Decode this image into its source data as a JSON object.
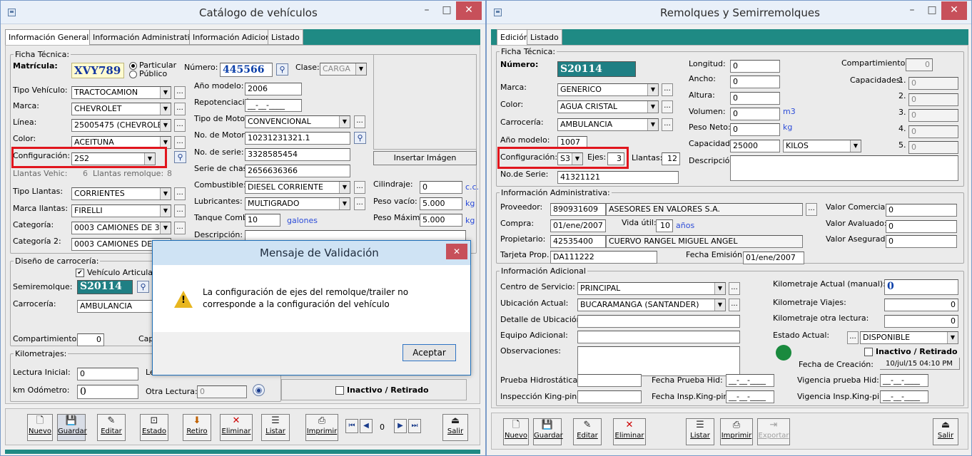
{
  "left": {
    "title": "Catálogo de vehículos",
    "tabs": [
      "Información General",
      "Información Administrativa",
      "Información Adicional",
      "Listado"
    ],
    "ficha": {
      "group_label": "Ficha Técnica:",
      "matricula_label": "Matrícula:",
      "matricula": "XVY789",
      "particular": "Particular",
      "publico": "Público",
      "numero_label": "Número:",
      "numero": "445566",
      "clase_label": "Clase:",
      "clase": "CARGA",
      "tipo_vehiculo_label": "Tipo Vehículo:",
      "tipo_vehiculo": "TRACTOCAMION",
      "marca_label": "Marca:",
      "marca": "CHEVROLET",
      "linea_label": "Línea:",
      "linea": "25005475 (CHEVROLET)",
      "color_label": "Color:",
      "color": "ACEITUNA",
      "configuracion_label": "Configuración:",
      "configuracion": "2S2",
      "llantas_veh_label": "Llantas Vehic:",
      "llantas_veh": "6",
      "llantas_rem_label": "Llantas remolque:",
      "llantas_rem": "8",
      "tipo_llantas_label": "Tipo Llantas:",
      "tipo_llantas": "CORRIENTES",
      "marca_llantas_label": "Marca llantas:",
      "marca_llantas": "FIRELLI",
      "categoria_label": "Categoría:",
      "categoria": "0003 CAMIONES DE 3 Y",
      "categoria2_label": "Categoría 2:",
      "categoria2": "0003 CAMIONES DE 3 Y",
      "anio_modelo_label": "Año modelo:",
      "anio_modelo": "2006",
      "repotenciacion_label": "Repotenciación",
      "repotenciacion": "__-__-____",
      "tipo_motor_label": "Tipo de Motor:",
      "tipo_motor": "CONVENCIONAL",
      "no_motor_label": "No. de Motor:",
      "no_motor": "10231231321.1",
      "no_serie_label": "No. de serie:",
      "no_serie": "3328585454",
      "serie_chasis_label": "Serie de chasis",
      "serie_chasis": "2656636366",
      "combustible_label": "Combustible:",
      "combustible": "DIESEL CORRIENTE",
      "lubricantes_label": "Lubricantes:",
      "lubricantes": "MULTIGRADO",
      "tanque_label": "Tanque Comb:",
      "tanque": "10",
      "galones": "galones",
      "descripcion_label": "Descripción:",
      "insertar_imagen": "Insertar Imágen",
      "cilindraje_label": "Cilindraje:",
      "cilindraje": "0",
      "cc": "c.c.",
      "peso_vacio_label": "Peso vacío:",
      "peso_vacio": "5.000",
      "peso_max_label": "Peso Máximo:",
      "peso_max": "5.000",
      "kg": "kg"
    },
    "carroceria": {
      "group_label": "Diseño de carrocería:",
      "vehiculo_articulado": "Vehículo Articulado",
      "semiremolque_label": "Semiremolque:",
      "semiremolque": "S20114",
      "carroceria_label": "Carrocería:",
      "carroceria": "AMBULANCIA",
      "compartimientos_label": "Compartimientos",
      "compartimientos": "0",
      "cap_label": "Cap"
    },
    "km": {
      "group_label": "Kilometrajes:",
      "lectura_inicial_label": "Lectura Inicial:",
      "lectura_inicial": "0",
      "le_label": "Le",
      "odometro_label": "km Odómetro:",
      "odometro": "0",
      "otra_lectura_label": "Otra Lectura:",
      "otra_lectura": "0",
      "inactivo": "Inactivo / Retirado"
    },
    "toolbar": {
      "nuevo": "Nuevo",
      "guardar": "Guardar",
      "editar": "Editar",
      "estado": "Estado",
      "retiro": "Retiro",
      "eliminar": "Eliminar",
      "listar": "Listar",
      "imprimir": "Imprimir",
      "page": "0",
      "salir": "Salir"
    }
  },
  "dialog": {
    "title": "Mensaje de Validación",
    "message": "La configuración de ejes del remolque/trailer no corresponde a la configuración del vehículo",
    "accept": "Aceptar"
  },
  "right": {
    "title": "Remolques y Semirremolques",
    "tabs": [
      "Edición",
      "Listado"
    ],
    "ficha": {
      "group_label": "Ficha Técnica:",
      "numero_label": "Número:",
      "numero": "S20114",
      "marca_label": "Marca:",
      "marca": "GENERICO",
      "color_label": "Color:",
      "color": "AGUA CRISTAL",
      "carroceria_label": "Carrocería:",
      "carroceria": "AMBULANCIA",
      "anio_modelo_label": "Año modelo:",
      "anio_modelo": "1007",
      "configuracion_label": "Configuración:",
      "configuracion": "S3",
      "ejes_label": "Ejes:",
      "ejes": "3",
      "llantas_label": "Llantas:",
      "llantas": "12",
      "no_serie_label": "No.de Serie:",
      "no_serie": "41321121",
      "longitud_label": "Longitud:",
      "longitud": "0",
      "ancho_label": "Ancho:",
      "ancho": "0",
      "altura_label": "Altura:",
      "altura": "0",
      "volumen_label": "Volumen:",
      "volumen": "0",
      "m3": "m3",
      "peso_neto_label": "Peso Neto:",
      "peso_neto": "0",
      "kg": "kg",
      "capacidad_label": "Capacidad:",
      "capacidad": "25000",
      "capacidad_unidad": "KILOS",
      "descripcion_label": "Descripción:",
      "compartimientos_label": "Compartimientos:",
      "compartimientos": "0",
      "capacidades_label": "Capacidades:",
      "cap_numbers": [
        "1.",
        "2.",
        "3.",
        "4.",
        "5."
      ],
      "cap_values": [
        "0",
        "0",
        "0",
        "0",
        "0"
      ]
    },
    "admin": {
      "group_label": "Información Administrativa:",
      "proveedor_label": "Proveedor:",
      "proveedor_id": "890931609",
      "proveedor_name": "ASESORES EN VALORES S.A.",
      "compra_label": "Compra:",
      "compra": "01/ene/2007",
      "vida_util_label": "Vida útil:",
      "vida_util": "10",
      "anios": "años",
      "propietario_label": "Propietario:",
      "propietario_id": "42535400",
      "propietario_name": "CUERVO RANGEL MIGUEL ANGEL",
      "tarjeta_label": "Tarjeta Prop.",
      "tarjeta": "DA111222",
      "fecha_emision_label": "Fecha Emisión:",
      "fecha_emision": "01/ene/2007",
      "valor_comercial_label": "Valor Comercial:",
      "valor_comercial": "0",
      "valor_avaluado_label": "Valor Avaluado:",
      "valor_avaluado": "0",
      "valor_asegurado_label": "Valor Asegurado:",
      "valor_asegurado": "0"
    },
    "adicional": {
      "group_label": "Información Adicional",
      "centro_label": "Centro de Servicio:",
      "centro": "PRINCIPAL",
      "ubicacion_label": "Ubicación Actual:",
      "ubicacion": "BUCARAMANGA  (SANTANDER)",
      "detalle_label": "Detalle de Ubicación:",
      "equipo_label": "Equipo Adicional:",
      "observaciones_label": "Observaciones:",
      "km_actual_label": "Kilometraje Actual (manual):",
      "km_actual": "0",
      "km_viajes_label": "Kilometraje Viajes:",
      "km_viajes": "0",
      "km_otra_label": "Kilometraje otra lectura:",
      "km_otra": "0",
      "estado_label": "Estado Actual:",
      "estado": "DISPONIBLE",
      "inactivo": "Inactivo / Retirado",
      "fecha_creacion_label": "Fecha de Creación:",
      "fecha_creacion": "10/jul/15 04:10 PM",
      "prueba_label": "Prueba Hidrostática:",
      "fecha_prueba_label": "Fecha Prueba Hid:",
      "vigencia_prueba_label": "Vigencia prueba Hid:",
      "inspeccion_label": "Inspección King-pin:",
      "fecha_insp_label": "Fecha Insp.King-pin:",
      "vigencia_insp_label": "Vigencia Insp.King-pin:",
      "date_mask": "__-__-____"
    },
    "toolbar": {
      "nuevo": "Nuevo",
      "guardar": "Guardar",
      "editar": "Editar",
      "eliminar": "Eliminar",
      "listar": "Listar",
      "imprimir": "Imprimir",
      "exportar": "Exportar",
      "salir": "Salir"
    }
  }
}
